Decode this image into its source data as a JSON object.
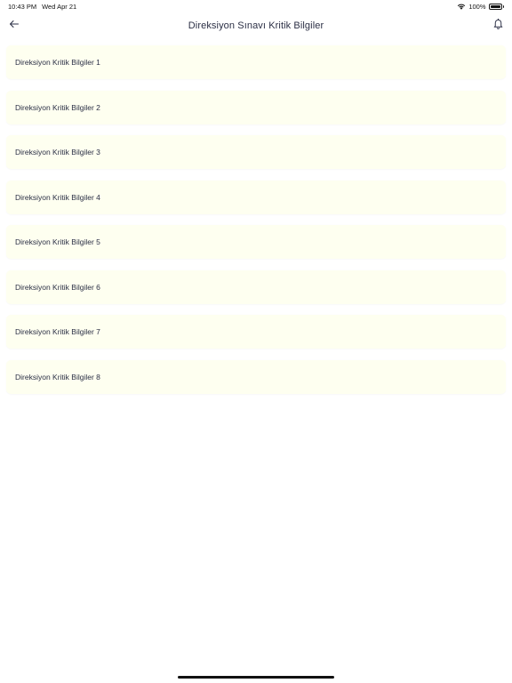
{
  "status_bar": {
    "time": "10:43 PM",
    "date": "Wed Apr 21",
    "battery_text": "100%",
    "battery_level": 1.0,
    "icons": [
      "wifi-icon",
      "battery-icon"
    ]
  },
  "nav": {
    "title": "Direksiyon Sınavı Kritik Bilgiler",
    "back_icon": "arrow-left-icon",
    "bell_icon": "bell-icon"
  },
  "colors": {
    "item_background": "#fefff0",
    "text": "#2b2f45"
  },
  "list": {
    "items": [
      {
        "label": "Direksiyon Kritik Bilgiler 1"
      },
      {
        "label": "Direksiyon Kritik Bilgiler 2"
      },
      {
        "label": "Direksiyon Kritik Bilgiler 3"
      },
      {
        "label": "Direksiyon Kritik Bilgiler 4"
      },
      {
        "label": "Direksiyon Kritik Bilgiler 5"
      },
      {
        "label": "Direksiyon Kritik Bilgiler 6"
      },
      {
        "label": "Direksiyon Kritik Bilgiler 7"
      },
      {
        "label": "Direksiyon Kritik Bilgiler 8"
      }
    ]
  }
}
